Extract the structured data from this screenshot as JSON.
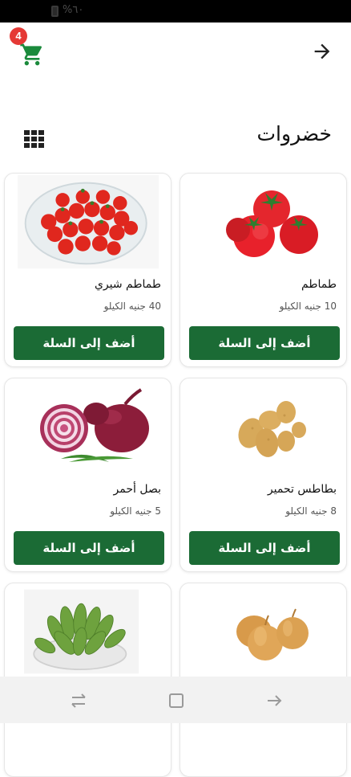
{
  "status_bar": {
    "battery_text": "%٦٠"
  },
  "header": {
    "cart_badge": "4",
    "cart_icon": "cart-icon",
    "back_icon": "arrow-right-icon"
  },
  "page": {
    "title": "خضروات",
    "view_toggle_icon": "grid-icon"
  },
  "products": [
    {
      "name": "طماطم",
      "price": "10 جنيه الكيلو",
      "button": "أضف إلى السلة",
      "image": "tomatoes"
    },
    {
      "name": "طماطم شيري",
      "price": "40 جنيه الكيلو",
      "button": "أضف إلى السلة",
      "image": "cherry-tomatoes-bowl"
    },
    {
      "name": "بطاطس تحمير",
      "price": "8 جنيه الكيلو",
      "button": "أضف إلى السلة",
      "image": "potatoes"
    },
    {
      "name": "بصل أحمر",
      "price": "5 جنيه الكيلو",
      "button": "أضف إلى السلة",
      "image": "red-onion"
    },
    {
      "name": "",
      "price": "",
      "button": "",
      "image": "onions"
    },
    {
      "name": "",
      "price": "",
      "button": "",
      "image": "okra-bowl"
    }
  ],
  "nav": {
    "recent_icon": "recents-icon",
    "home_icon": "home-square-icon",
    "back_icon": "back-arrow-icon"
  },
  "colors": {
    "primary_green": "#1b6b35",
    "badge_red": "#e53935",
    "cart_green": "#1b8a3c"
  }
}
